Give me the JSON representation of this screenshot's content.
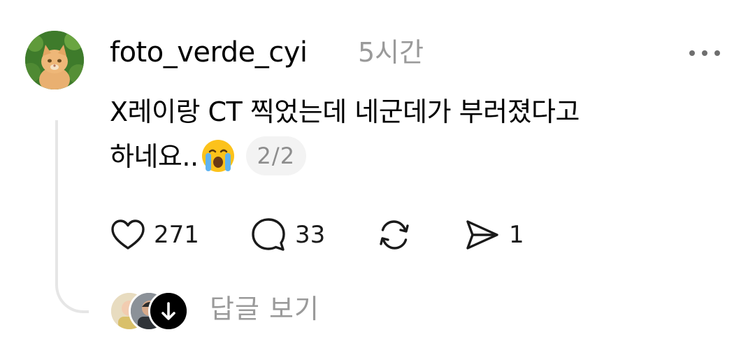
{
  "post": {
    "username": "foto_verde_cyi",
    "time": "5시간",
    "text_line1": "X레이랑 CT 찍었는데 네군데가 부러졌다고",
    "text_line2": "하네요..",
    "emoji": "loudly-crying-face",
    "thread_counter": "2/2"
  },
  "actions": {
    "like_count": "271",
    "comment_count": "33",
    "repost_count": "",
    "share_count": "1"
  },
  "replies": {
    "label": "답글 보기"
  },
  "colors": {
    "text": "#000000",
    "muted": "#9a9a9a",
    "thread_line": "#e6e6e6",
    "counter_bg": "#f3f3f3"
  }
}
